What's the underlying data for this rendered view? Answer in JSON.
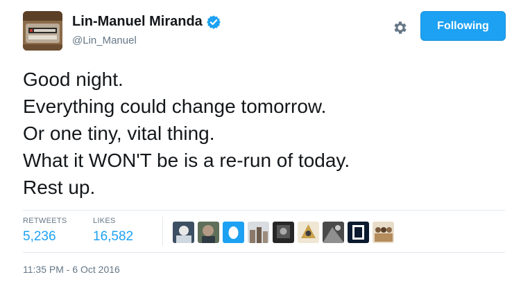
{
  "author": {
    "display_name": "Lin-Manuel Miranda",
    "handle": "@Lin_Manuel",
    "verified": true
  },
  "actions": {
    "settings_icon": "gear-icon",
    "follow_label": "Following",
    "follow_color": "#1da1f2"
  },
  "tweet": {
    "lines": [
      "Good night.",
      "Everything could change tomorrow.",
      "Or one tiny, vital thing.",
      "What it WON'T be is a re-run of today.",
      "Rest up."
    ]
  },
  "stats": {
    "retweets_label": "RETWEETS",
    "retweets_count": "5,236",
    "likes_label": "LIKES",
    "likes_count": "16,582"
  },
  "likers": {
    "count_shown": 9
  },
  "timestamp": "11:35 PM - 6 Oct 2016"
}
